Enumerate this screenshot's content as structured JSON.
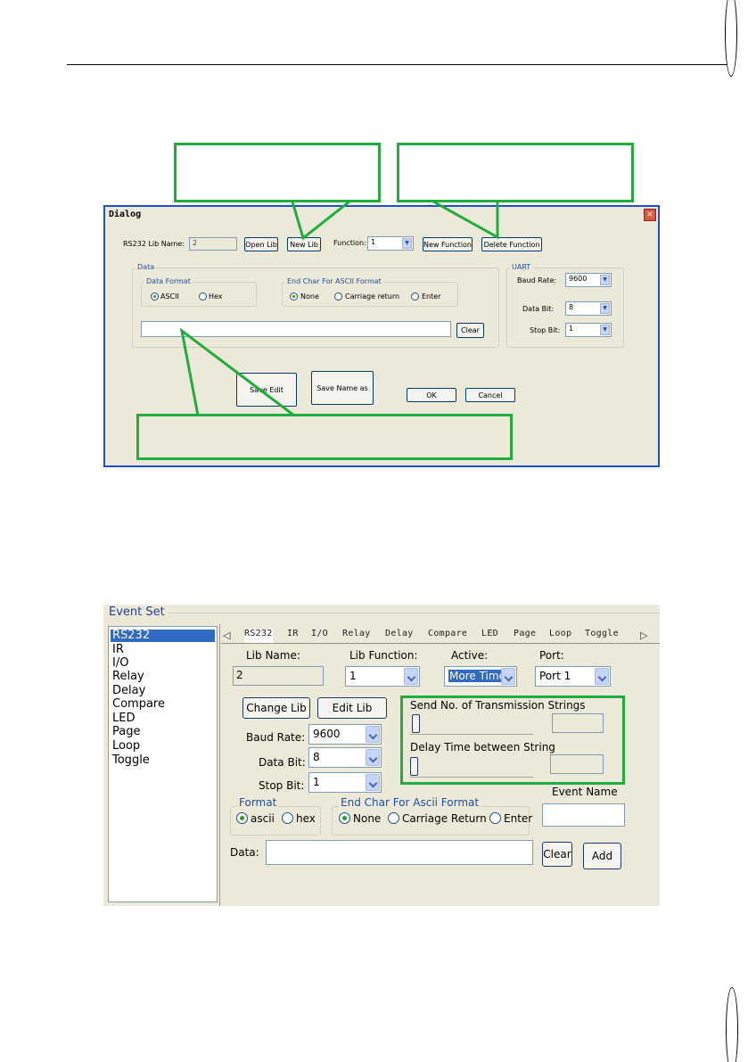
{
  "dialog": {
    "title": "Dialog",
    "close_glyph": "×",
    "lib_name_label": "RS232 Lib Name:",
    "lib_name_value": "2",
    "open_lib": "Open Lib",
    "new_lib": "New Lib",
    "function_label": "Function:",
    "function_value": "1",
    "new_function": "New Function",
    "delete_function": "Delete Function",
    "data_group": "Data",
    "data_format_group": "Data Format",
    "format_options": [
      "ASCII",
      "Hex"
    ],
    "end_char_group": "End Char For ASCII Format",
    "end_char_options": [
      "None",
      "Carriage return",
      "Enter"
    ],
    "clear": "Clear",
    "uart_group": "UART",
    "baud_rate_label": "Baud Rate:",
    "baud_rate_value": "9600",
    "data_bit_label": "Data Bit:",
    "data_bit_value": "8",
    "stop_bit_label": "Stop Bit:",
    "stop_bit_value": "1",
    "save_edit": "Save Edit",
    "save_name_as": "Save Name as",
    "ok": "OK",
    "cancel": "Cancel"
  },
  "event_set": {
    "title": "Event Set",
    "list_items": [
      "RS232",
      "IR",
      "I/O",
      "Relay",
      "Delay",
      "Compare",
      "LED",
      "Page",
      "Loop",
      "Toggle"
    ],
    "selected_item": "RS232",
    "tabs": [
      "RS232",
      "IR",
      "I/O",
      "Relay",
      "Delay",
      "Compare",
      "LED",
      "Page",
      "Loop",
      "Toggle"
    ],
    "tab_prev_glyph": "◁",
    "tab_next_glyph": "▷",
    "lib_name_label": "Lib Name:",
    "lib_name_value": "2",
    "lib_function_label": "Lib Function:",
    "lib_function_value": "1",
    "active_label": "Active:",
    "active_value": "More Time",
    "port_label": "Port:",
    "port_value": "Port 1",
    "change_lib": "Change Lib",
    "edit_lib": "Edit Lib",
    "baud_rate_label": "Baud Rate:",
    "baud_rate_value": "9600",
    "data_bit_label": "Data Bit:",
    "data_bit_value": "8",
    "stop_bit_label": "Stop Bit:",
    "stop_bit_value": "1",
    "send_no_label": "Send No. of Transmission Strings",
    "delay_label": "Delay Time between String",
    "event_name_label": "Event Name",
    "format_group": "Format",
    "format_options": [
      "ascii",
      "hex"
    ],
    "end_char_group": "End Char For Ascii Format",
    "end_char_options": [
      "None",
      "Carriage Return",
      "Enter"
    ],
    "data_label": "Data:",
    "clear": "Clear",
    "add": "Add"
  },
  "colors": {
    "callout": "#1fae3c",
    "dialog_bg": "#ece9d8",
    "selection": "#316ac5"
  }
}
